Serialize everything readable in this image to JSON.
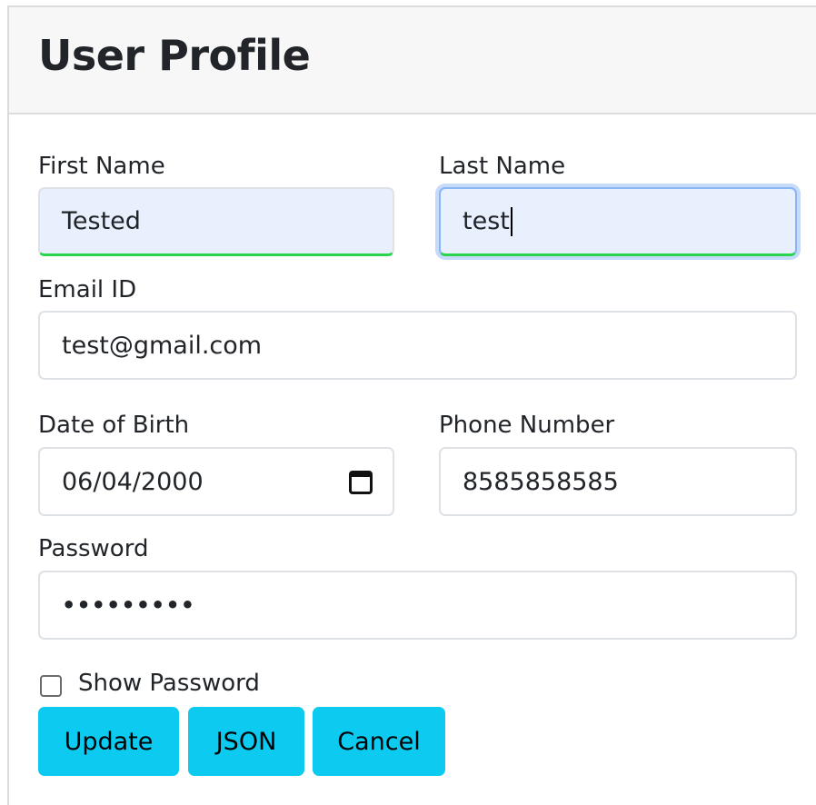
{
  "header": {
    "title": "User Profile"
  },
  "form": {
    "first_name": {
      "label": "First Name",
      "value": "Tested"
    },
    "last_name": {
      "label": "Last Name",
      "value": "test"
    },
    "email": {
      "label": "Email ID",
      "value": "test@gmail.com"
    },
    "dob": {
      "label": "Date of Birth",
      "value": "06/04/2000",
      "icon": "calendar-icon"
    },
    "phone": {
      "label": "Phone Number",
      "value": "8585858585"
    },
    "password": {
      "label": "Password",
      "value": "•••••••••"
    },
    "show_password": {
      "label": "Show Password",
      "checked": false
    }
  },
  "buttons": {
    "update": "Update",
    "json": "JSON",
    "cancel": "Cancel"
  },
  "colors": {
    "button_bg": "#0dcaf0",
    "autofill_bg": "#e8f0fe",
    "valid_border": "#2ad44d",
    "focus_ring": "#c6dafa"
  }
}
